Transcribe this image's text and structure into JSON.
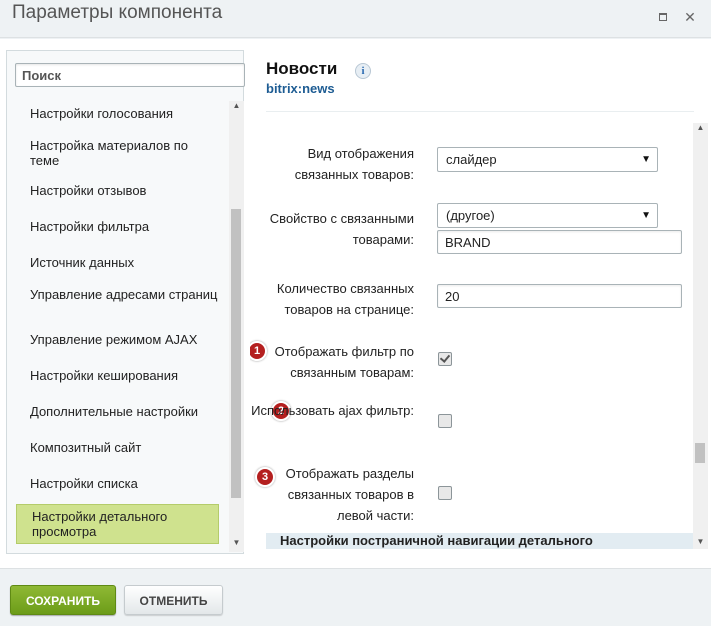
{
  "window": {
    "title": "Параметры компонента"
  },
  "sidebar": {
    "search_placeholder": "Поиск",
    "items": [
      {
        "label": "Настройки голосования"
      },
      {
        "label": "Настройка материалов по теме"
      },
      {
        "label": "Настройки отзывов"
      },
      {
        "label": "Настройки фильтра"
      },
      {
        "label": "Источник данных"
      },
      {
        "label": "Управление адресами страниц"
      },
      {
        "label": "Управление режимом AJAX"
      },
      {
        "label": "Настройки кеширования"
      },
      {
        "label": "Дополнительные настройки"
      },
      {
        "label": "Композитный сайт"
      },
      {
        "label": "Настройки списка"
      },
      {
        "label": "Настройки детального просмотра",
        "active": true
      }
    ]
  },
  "component": {
    "name": "Новости",
    "code": "bitrix:news",
    "info_glyph": "i"
  },
  "params": {
    "view_mode": {
      "label": "Вид отображения связанных товаров:",
      "value": "слайдер"
    },
    "prop_linked": {
      "label": "Свойство с связанными товарами:",
      "select_value": "(другое)",
      "text_value": "BRAND"
    },
    "count": {
      "label": "Количество связанных товаров на странице:",
      "value": "20"
    },
    "show_filter": {
      "label": "Отображать фильтр по связанным товарам:",
      "checked": true,
      "badge": "1"
    },
    "ajax_filter": {
      "label": "Использовать ajax фильтр:",
      "checked": false,
      "badge": "2"
    },
    "show_sections": {
      "label": "Отображать разделы связанных товаров в левой части:",
      "checked": false,
      "badge": "3"
    },
    "next_section": "Настройки постраничной навигации детального"
  },
  "footer": {
    "save_label": "СОХРАНИТЬ",
    "cancel_label": "ОТМЕНИТЬ"
  },
  "colors": {
    "save_green": "#7aa822",
    "active_item": "#cfe28e",
    "badge_red": "#b41f1f",
    "link_blue": "#1d5c93"
  }
}
